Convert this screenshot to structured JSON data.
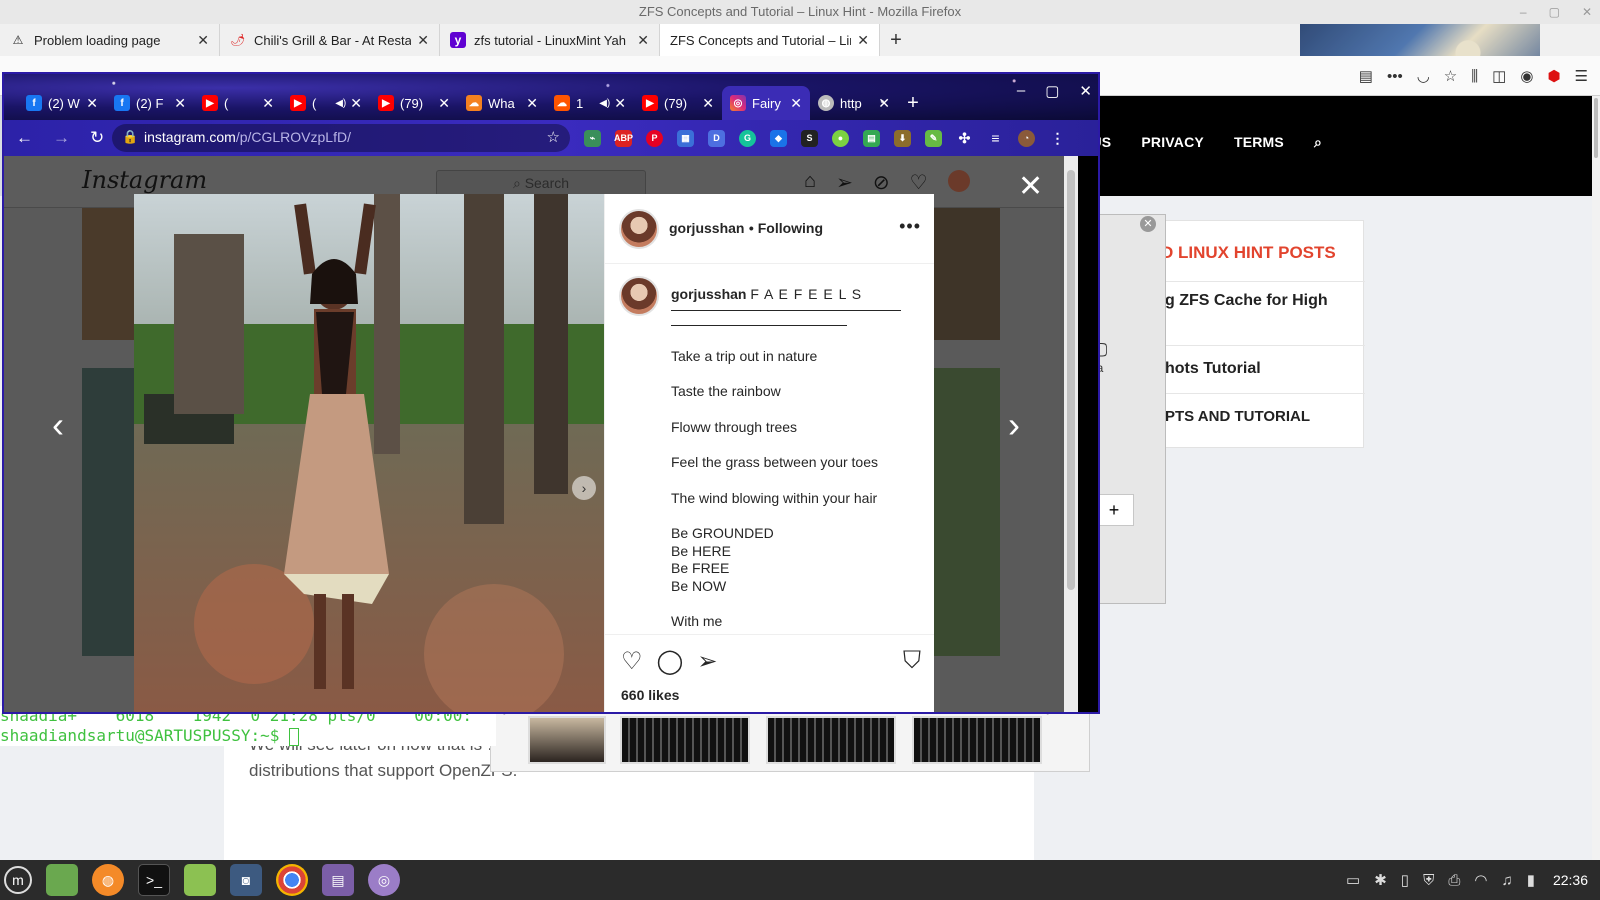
{
  "firefox": {
    "window_title": "ZFS Concepts and Tutorial – Linux Hint - Mozilla Firefox",
    "tabs": [
      {
        "label": "Problem loading page",
        "icon": "warning-icon"
      },
      {
        "label": "Chili's Grill & Bar - At Resta",
        "icon": "chili-icon"
      },
      {
        "label": "zfs tutorial - LinuxMint Yah",
        "icon": "yahoo-icon"
      },
      {
        "label": "ZFS Concepts and Tutorial – Lin",
        "icon": "linuxhint-icon",
        "active": true
      }
    ],
    "new_tab": "+"
  },
  "linuxhint": {
    "menu": [
      "OR US",
      "PRIVACY",
      "TERMS"
    ],
    "sidebar_title": "D LINUX HINT POSTS",
    "sidebar_rows": [
      "g ZFS Cache for High",
      "hots Tutorial",
      "PTS AND TUTORIAL"
    ],
    "article_text": "We will see later on how that is … commands and underlying architecture are similar for all the Linux distributions that support OpenZFS.",
    "dialog_add": "+",
    "dialog_icon_label": "ea"
  },
  "terminal": {
    "line1": "shaadia+    6018    1942  0 21:28 pts/0    00:00:",
    "prompt": "shaadiandsartu@SARTUSPUSSY:~$ "
  },
  "chrome": {
    "tabs": [
      {
        "label": "(2) W",
        "favicon_color": "#1877f2",
        "glyph": "f"
      },
      {
        "label": "(2) F",
        "favicon_color": "#1877f2",
        "glyph": "f"
      },
      {
        "label": "(",
        "favicon_color": "#ff0000",
        "glyph": "▶"
      },
      {
        "label": "(",
        "favicon_color": "#ff0000",
        "glyph": "▶"
      },
      {
        "label": "(79)",
        "favicon_color": "#ff0000",
        "glyph": "▶"
      },
      {
        "label": "Wha",
        "favicon_color": "#f48120",
        "glyph": "☁"
      },
      {
        "label": "1",
        "favicon_color": "#ff5500",
        "glyph": "☁"
      },
      {
        "label": "(79)",
        "favicon_color": "#ff0000",
        "glyph": "▶"
      },
      {
        "label": "Fairy",
        "favicon_color": "#c13584",
        "glyph": "◎",
        "active": true
      },
      {
        "label": "http",
        "favicon_color": "#9e9e9e",
        "glyph": "🌐"
      }
    ],
    "url_host": "instagram.com",
    "url_path": "/p/CGLROVzpLfD/"
  },
  "instagram": {
    "logo": "Instagram",
    "search_placeholder": "Search",
    "username": "gorjusshan",
    "following": "• Following",
    "caption_title": "F A E F E E L S",
    "caption_lines": [
      "Take a trip out in nature",
      "Taste the rainbow",
      "Floww through trees",
      "Feel the grass between your toes",
      "The wind blowing within your hair"
    ],
    "be_lines": [
      "Be GROUNDED",
      "Be HERE",
      "Be FREE",
      "Be NOW"
    ],
    "cut_line": "With me",
    "likes": "660 likes"
  },
  "taskbar": {
    "clock": "22:36"
  }
}
